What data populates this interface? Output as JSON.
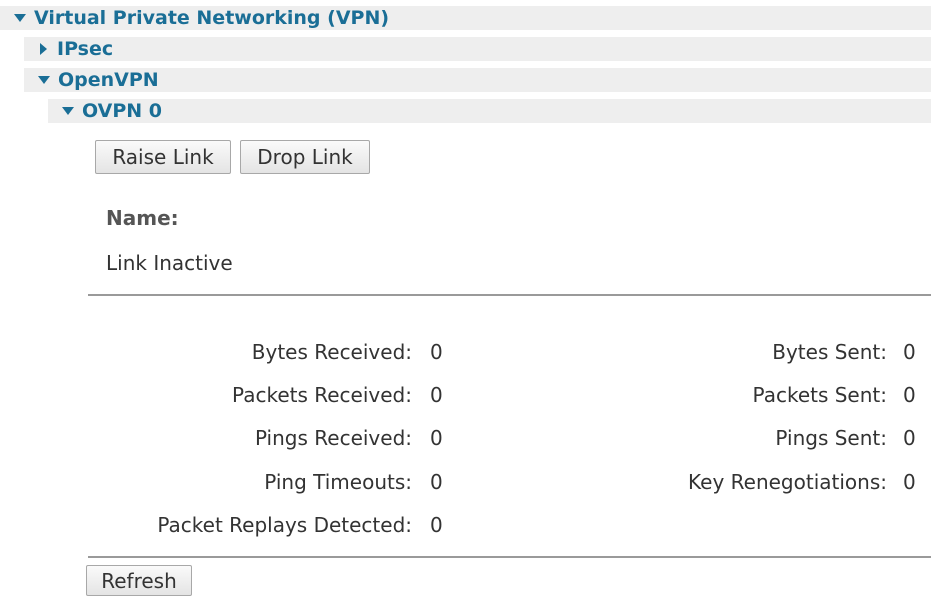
{
  "tree": {
    "vpn": "Virtual Private Networking (VPN)",
    "ipsec": "IPsec",
    "openvpn": "OpenVPN",
    "ovpn0": "OVPN 0"
  },
  "buttons": {
    "raise_link": "Raise Link",
    "drop_link": "Drop Link",
    "refresh": "Refresh"
  },
  "info": {
    "name_label": "Name:",
    "link_status": "Link Inactive"
  },
  "stats": {
    "bytes_received_label": "Bytes Received:",
    "bytes_received": "0",
    "packets_received_label": "Packets Received:",
    "packets_received": "0",
    "pings_received_label": "Pings Received:",
    "pings_received": "0",
    "ping_timeouts_label": "Ping Timeouts:",
    "ping_timeouts": "0",
    "packet_replays_label": "Packet Replays Detected:",
    "packet_replays": "0",
    "bytes_sent_label": "Bytes Sent:",
    "bytes_sent": "0",
    "packets_sent_label": "Packets Sent:",
    "packets_sent": "0",
    "pings_sent_label": "Pings Sent:",
    "pings_sent": "0",
    "key_renegotiations_label": "Key Renegotiations:",
    "key_renegotiations": "0"
  },
  "colors": {
    "tree_text": "#1a6e96",
    "tree_row_bg": "#eeeeee",
    "divider": "#9a9a9a"
  }
}
